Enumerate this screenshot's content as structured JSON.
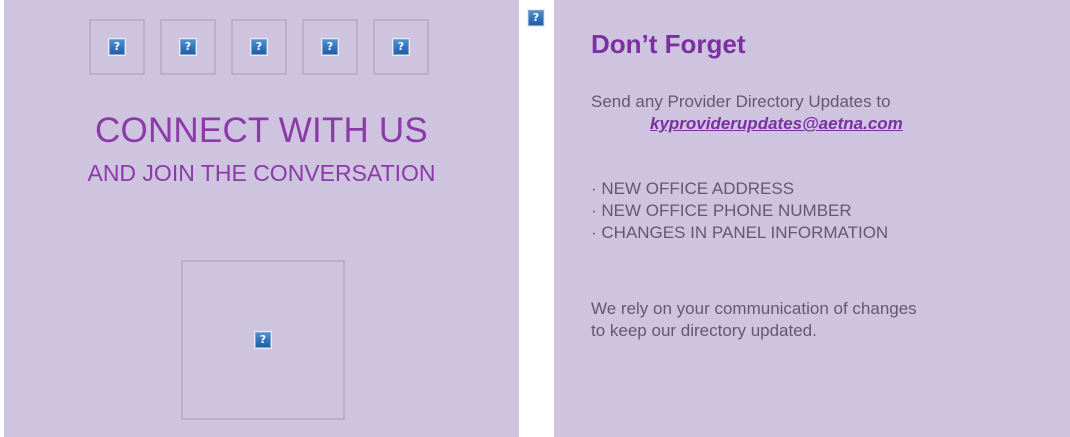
{
  "left_panel": {
    "social_icons": [
      "broken-image-icon",
      "broken-image-icon",
      "broken-image-icon",
      "broken-image-icon",
      "broken-image-icon"
    ],
    "title": "CONNECT WITH US",
    "subtitle": "AND JOIN THE CONVERSATION",
    "broken_image_glyph": "?"
  },
  "right_panel": {
    "heading": "Don’t Forget",
    "intro": "Send any Provider Directory Updates to",
    "email": "kyproviderupdates@aetna.com",
    "bullets": [
      "· NEW OFFICE ADDRESS",
      "· NEW OFFICE PHONE NUMBER",
      "· CHANGES IN PANEL INFORMATION"
    ],
    "closing_line1": "We rely on your communication of changes",
    "closing_line2": "to keep our directory updated."
  },
  "colors": {
    "panel_bg": "#cec4e0",
    "accent_purple": "#8b3aa8",
    "body_text": "#625a6c"
  }
}
